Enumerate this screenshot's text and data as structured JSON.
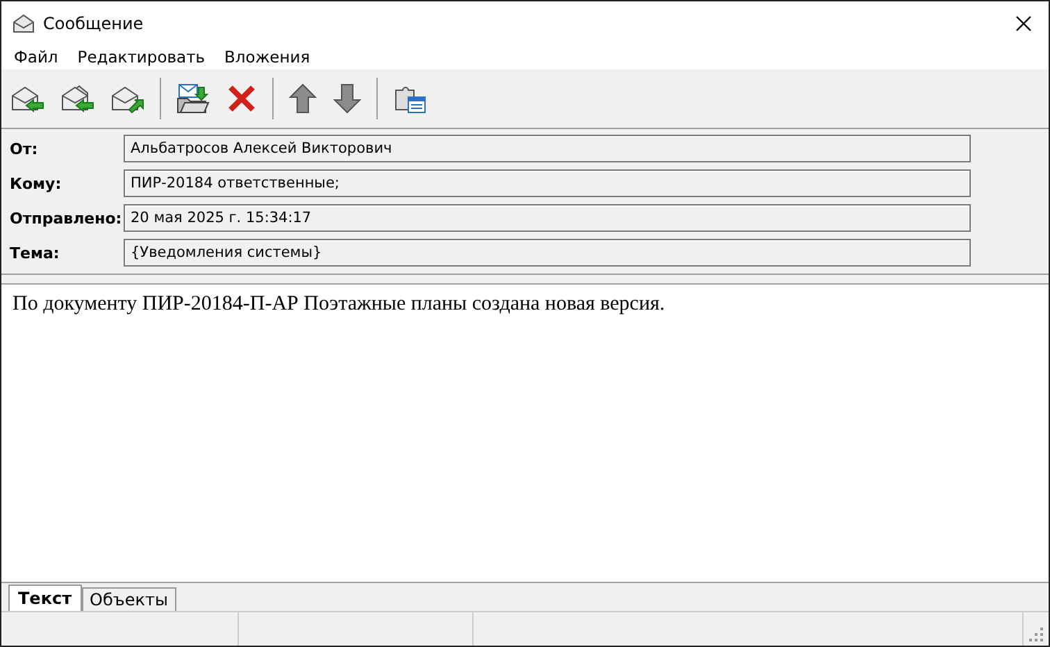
{
  "window": {
    "title": "Сообщение"
  },
  "menu": [
    "Файл",
    "Редактировать",
    "Вложения"
  ],
  "toolbar": [
    {
      "kind": "reply"
    },
    {
      "kind": "reply_all"
    },
    {
      "kind": "forward"
    },
    {
      "kind": "separator"
    },
    {
      "kind": "save"
    },
    {
      "kind": "delete"
    },
    {
      "kind": "separator"
    },
    {
      "kind": "up"
    },
    {
      "kind": "down"
    },
    {
      "kind": "separator"
    },
    {
      "kind": "objects"
    }
  ],
  "fields": [
    {
      "label": "От:",
      "value": "Альбатросов Алексей Викторович"
    },
    {
      "label": "Кому:",
      "value": "ПИР-20184 ответственные;"
    },
    {
      "label": "Отправлено:",
      "value": "20 мая 2025 г. 15:34:17"
    },
    {
      "label": "Тема:",
      "value": "{Уведомления системы}"
    }
  ],
  "body": "По документу ПИР-20184-П-АР Поэтажные планы создана новая версия.",
  "tabs": [
    {
      "label": "Текст",
      "selected": true
    },
    {
      "label": "Объекты",
      "selected": false
    }
  ]
}
